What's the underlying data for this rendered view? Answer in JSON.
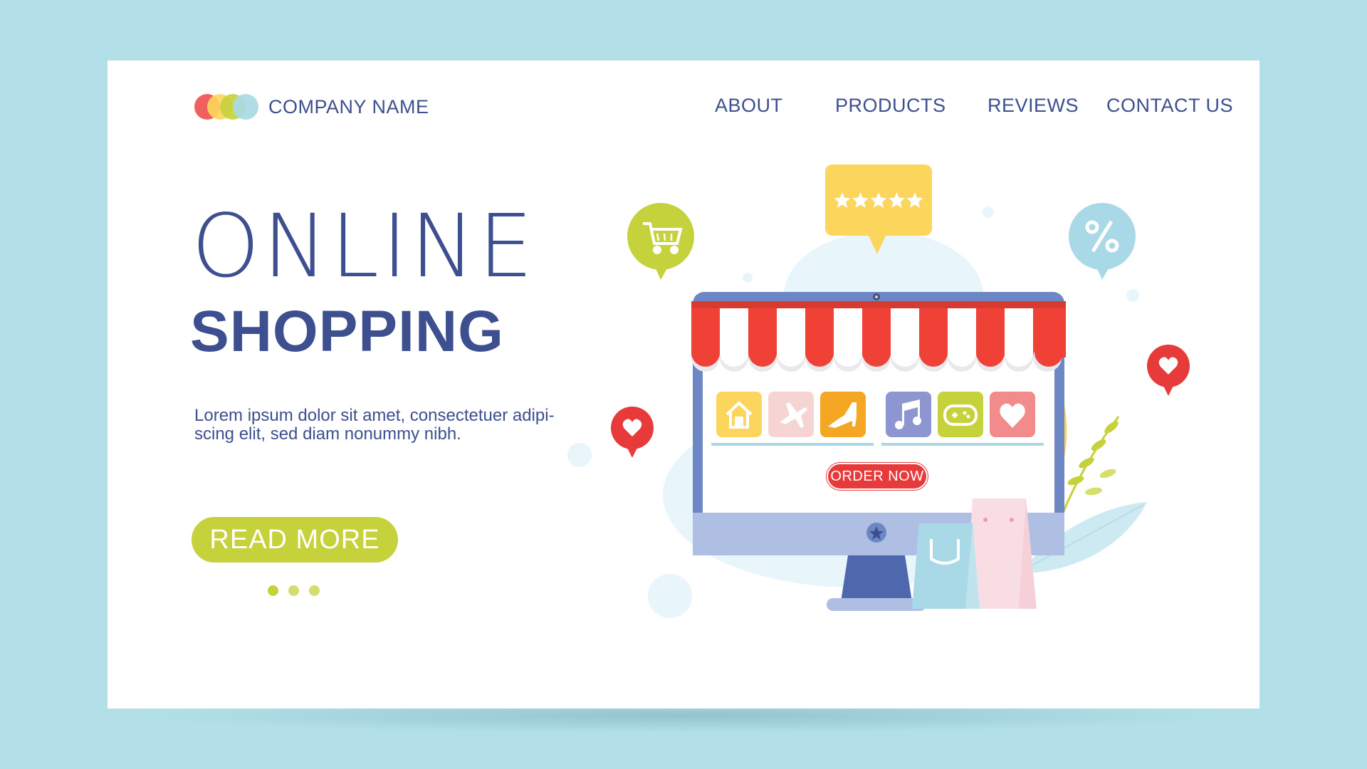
{
  "colors": {
    "background": "#b3e0e8",
    "primary_text": "#3d4f8f",
    "accent_green": "#c5d23c",
    "accent_red": "#e73b3b",
    "accent_yellow": "#fcd65c",
    "accent_blue": "#a9d9e6"
  },
  "header": {
    "logo_circle_colors": [
      "#ef5350",
      "#fcd65c",
      "#c5d23c",
      "#a9d9e6"
    ],
    "company_name": "COMPANY NAME",
    "nav": [
      {
        "label": "ABOUT"
      },
      {
        "label": "PRODUCTS"
      },
      {
        "label": "REVIEWS"
      },
      {
        "label": "CONTACT US"
      }
    ]
  },
  "hero": {
    "title_line1": "ONLINE",
    "title_line2": "SHOPPING",
    "description_line1": "Lorem ipsum dolor sit amet, consectetuer adipi-",
    "description_line2": "scing elit, sed diam nonummy nibh.",
    "cta_label": "READ MORE",
    "carousel": {
      "slides": 3,
      "active_index": 0
    }
  },
  "illustration": {
    "order_button_label": "ORDER NOW",
    "rating_stars": 5,
    "badges": [
      "cart-icon",
      "rating-icon",
      "percent-icon",
      "heart-icon",
      "heart-icon"
    ],
    "product_tiles": [
      {
        "icon": "home-icon",
        "color": "#fcd65c"
      },
      {
        "icon": "airplane-icon",
        "color": "#f7d4d4"
      },
      {
        "icon": "shoe-icon",
        "color": "#f5a623"
      },
      {
        "icon": "music-icon",
        "color": "#8e96d1"
      },
      {
        "icon": "gamepad-icon",
        "color": "#c5d23c"
      },
      {
        "icon": "heart-icon",
        "color": "#f28b8b"
      }
    ]
  }
}
